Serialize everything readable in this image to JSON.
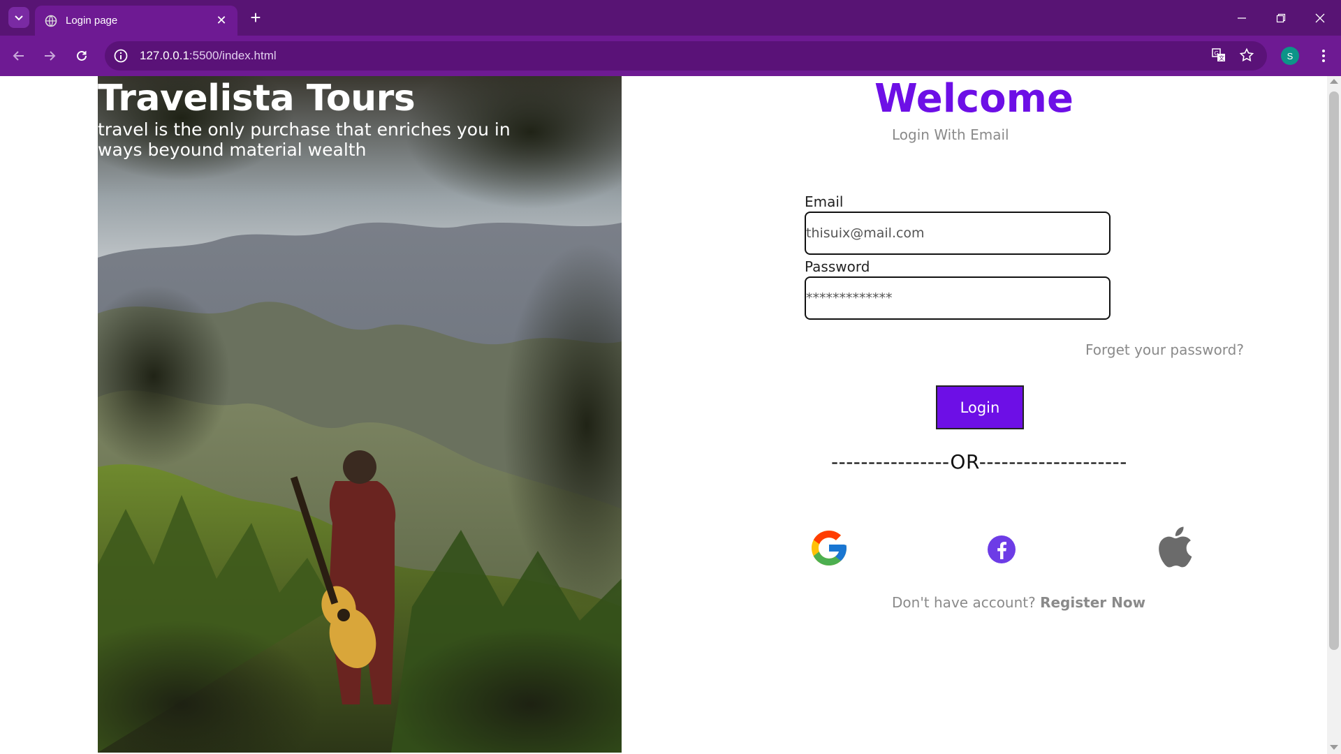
{
  "browser": {
    "tab_title": "Login page",
    "url_host": "127.0.0.1",
    "url_path": ":5500/index.html",
    "profile_initial": "S",
    "icons": [
      "tab-search-icon",
      "globe-icon",
      "close-icon",
      "new-tab-icon",
      "minimize-icon",
      "restore-icon",
      "window-close-icon",
      "back-icon",
      "forward-icon",
      "reload-icon",
      "info-icon",
      "translate-icon",
      "bookmark-star-icon",
      "menu-kebab-icon"
    ]
  },
  "hero": {
    "brand": "Travelista Tours",
    "tagline": "travel is the only purchase that enriches you in ways beyound material wealth"
  },
  "login": {
    "title": "Welcome",
    "subtitle": "Login With Email",
    "email_label": "Email",
    "email_value": "thisuix@mail.com",
    "password_label": "Password",
    "password_value": "*************",
    "forgot": "Forget your password?",
    "submit": "Login",
    "divider": "----------------OR--------------------",
    "social": [
      "google-icon",
      "facebook-icon",
      "apple-icon"
    ],
    "register_prompt": "Don't have account?",
    "register_link": "Register Now"
  },
  "colors": {
    "accent": "#6d0fe6",
    "chrome_dark": "#581474",
    "chrome": "#6e1a93",
    "muted_text": "#8a8a8a"
  }
}
